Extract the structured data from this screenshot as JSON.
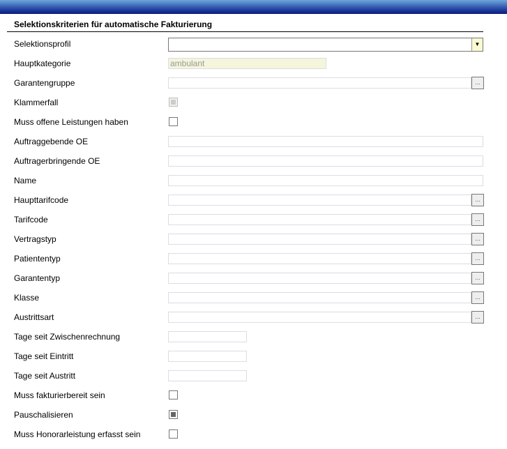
{
  "title": "Selektionskriterien für automatische Fakturierung",
  "lookup_button": "...",
  "rows": [
    {
      "label": "Selektionsprofil",
      "type": "select",
      "value": ""
    },
    {
      "label": "Hauptkategorie",
      "type": "readonly",
      "value": "ambulant"
    },
    {
      "label": "Garantengruppe",
      "type": "lookup",
      "value": ""
    },
    {
      "label": "Klammerfall",
      "type": "checkbox",
      "checked": true,
      "disabled": true
    },
    {
      "label": "Muss offene Leistungen haben",
      "type": "checkbox",
      "checked": false
    },
    {
      "label": "Auftraggebende OE",
      "type": "text",
      "value": ""
    },
    {
      "label": "Auftragerbringende OE",
      "type": "text",
      "value": ""
    },
    {
      "label": "Name",
      "type": "text",
      "value": ""
    },
    {
      "label": "Haupttarifcode",
      "type": "lookup",
      "value": ""
    },
    {
      "label": "Tarifcode",
      "type": "lookup",
      "value": ""
    },
    {
      "label": "Vertragstyp",
      "type": "lookup",
      "value": ""
    },
    {
      "label": "Patiententyp",
      "type": "lookup",
      "value": ""
    },
    {
      "label": "Garantentyp",
      "type": "lookup",
      "value": ""
    },
    {
      "label": "Klasse",
      "type": "lookup",
      "value": ""
    },
    {
      "label": "Austrittsart",
      "type": "lookup",
      "value": ""
    },
    {
      "label": "Tage seit Zwischenrechnung",
      "type": "short",
      "value": ""
    },
    {
      "label": "Tage seit Eintritt",
      "type": "short",
      "value": ""
    },
    {
      "label": "Tage seit Austritt",
      "type": "short",
      "value": ""
    },
    {
      "label": "Muss fakturierbereit sein",
      "type": "checkbox",
      "checked": false
    },
    {
      "label": "Pauschalisieren",
      "type": "checkbox",
      "checked": true
    },
    {
      "label": "Muss Honorarleistung erfasst sein",
      "type": "checkbox",
      "checked": false
    }
  ]
}
